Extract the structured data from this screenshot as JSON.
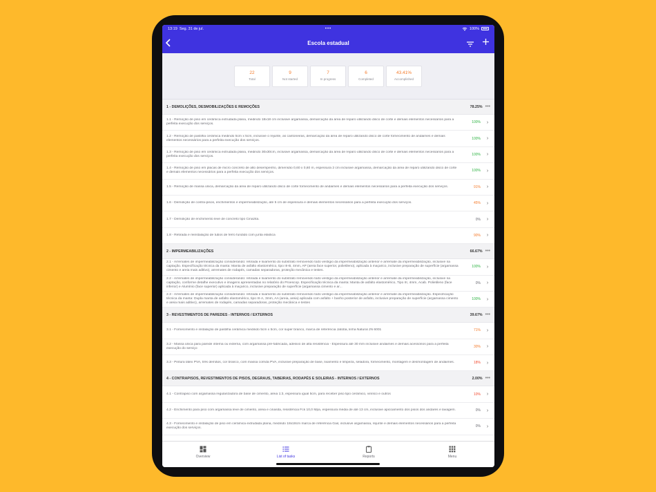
{
  "status": {
    "time": "13:19",
    "date": "Seg. 31 de jul.",
    "center": "•••",
    "battery": "100%"
  },
  "nav": {
    "title": "Escola estadual"
  },
  "colors": {
    "accent": "#3F33E0",
    "green": "#2FB344",
    "orange": "#F47A2A",
    "red": "#F2492E",
    "gray": "#6a6a72"
  },
  "stats": [
    {
      "value": "22",
      "label": "Total"
    },
    {
      "value": "9",
      "label": "Not started"
    },
    {
      "value": "7",
      "label": "In progress"
    },
    {
      "value": "6",
      "label": "Completed"
    },
    {
      "value": "43.41%",
      "label": "Accomplished"
    }
  ],
  "sections": [
    {
      "title": "1 - DEMOLIÇÕES, DESMOBILIZAÇÕES E REMOÇÕES",
      "percent": "78.25%",
      "items": [
        {
          "text": "1.1 - Remoção de piso em cerâmica extrudada plana, medindo 18x18 cm inclusive argamassa, demarcação da área de reparo utilizando disco de corte e demais elementos necessários para a perfeita execução dos serviços.",
          "percent": "100%",
          "status": "green"
        },
        {
          "text": "1.2 - Remoção de pastilha cerâmica medindo 5cm x 5cm, inclusive o rejunte, as cantoneiras, demarcação da área de reparo utilizando disco de corte fornecimento de andaimes e demais elementos necessários para a perfeita execução dos serviços.",
          "percent": "100%",
          "status": "green"
        },
        {
          "text": "1.3 - Remoção de piso em cerâmica extrudada plana, medindo 30x30cm, inclusive argamassa, demarcação da área de reparo utilizando disco de corte e demais elementos necessários para a perfeita execução dos serviços.",
          "percent": "100%",
          "status": "green"
        },
        {
          "text": "1.4 - Remoção de piso em placas de micro concreto de alto desempenho, dimensão 0,60 x 0,60 m, espessura 2 cm inclusive argamassa, demarcação da área de reparo utilizando disco de corte e demais elementos necessários para a perfeita execução dos serviços.",
          "percent": "100%",
          "status": "green"
        },
        {
          "text": "1.5 - Remoção de massa única, demarcação da área de reparo utilizando disco de corte fornecimento de andaimes e demais elementos necessários para a perfeita execução dos serviços.",
          "percent": "91%",
          "status": "orange"
        },
        {
          "text": "1.6 - Demolição de contra-pisos, enchimentos e impermeabilização, até 5 cm de espessura e demais elementos necessários para a perfeita execução dos serviços.",
          "percent": "45%",
          "status": "orange"
        },
        {
          "text": "1.7 - Demolição de enchimento leve de concreto tipo Cinazita.",
          "percent": "0%",
          "status": "gray"
        },
        {
          "text": "1.8 - Retirada e reinstalação de tubos de ferro fundido com junta elástica",
          "percent": "90%",
          "status": "orange"
        }
      ]
    },
    {
      "title": "2 - IMPERMEABILIZAÇÕES",
      "percent": "66.67%",
      "items": [
        {
          "text": "2.1 - Arremates de impermeabilização considerando: retirada e lixamento do substrato removendo todo vestígio da impermeabilização anterior e arremate da impermeabilização, inclusive na captação. Especificação técnica da manta: Manta de asfalto elastomérico, tipo III-B, 4mm, AP (areia face superior, polietileno), aplicada à maçarico, inclusive preparação de superfície (argamassa cimento e areia mais aditivo), arremates de rodapés, camadas separadoras, proteção mecânica e testes.",
          "percent": "100%",
          "status": "green"
        },
        {
          "text": "2.2 - Arremates de impermeabilização considerando: retirada e lixamento do substrato removendo todo vestígio da impermeabilização anterior e arremate da impermeabilização, inclusive na captação, conforme detalhe executivo e imagens apresentadas no relatório do Proescop. Especificação técnica da manta: Manta de asfalto elastomérico, Tipo III, 4mm, Acab. Polietileno (face inferior) e Alumínio (face superior) aplicada à maçarico, inclusive preparação de superfície (argamassa cimento e ar...",
          "percent": "0%",
          "status": "gray"
        },
        {
          "text": "2.3 - Arremates de impermeabilização considerando: retirada e lixamento do substrato removendo todo vestígio da impermeabilização anterior e arremate da impermeabilização. Especificação técnica da manta: Dupla manta de asfalto elastomérico, tipo III-A, 3mm, AA (areia, areia) aplicada com asfalto + banho posterior de asfalto, inclusive preparação de superfície (argamassa cimento e areia mais aditivo), arremates de rodapés, camadas separadoras, proteção mecânica e testes",
          "percent": "100%",
          "status": "green"
        }
      ]
    },
    {
      "title": "3 - REVESTIMENTOS DE PAREDES - INTERNOS / EXTERNOS",
      "percent": "39.67%",
      "items": [
        {
          "text": "3.1 - Fornecimento e instalação de pastilha cerâmica medindo 5cm x 5cm, cor super branco, marca de referência Jatobá, linha Natural JN 6001",
          "percent": "71%",
          "status": "orange"
        },
        {
          "text": "3.2 - Massa única para parede interna ou externa, com argamassa pré-fabricada, adesivo de alta resistência - Espessura até 30 mm inclusive andaimes e demais acessórios para a perfeita execução do serviço",
          "percent": "30%",
          "status": "orange"
        },
        {
          "text": "3.3 - Pintura látex PVA, três demãos, cor branco, com massa corrida PVA, inclusive preparação de base, lixamento e limpeza, seladora, fornecimento, montagem e desmontagem de andaimes.",
          "percent": "18%",
          "status": "red"
        }
      ]
    },
    {
      "title": "4 - CONTRAPISOS, REVESTIMENTOS DE PISOS, DEGRAUS, TABEIRAS, RODAPÉS E SOLEIRAS - INTERNOS / EXTERNOS",
      "percent": "2.00%",
      "items": [
        {
          "text": "4.1 - Contrapiso com argamassa regularizadora de base de cimento, areia 1:3, espessura igual 5cm, para receber piso tipo cerâmico, vinílico e outros",
          "percent": "10%",
          "status": "red"
        },
        {
          "text": "4.2 - Enchimento para piso com argamassa leve de cimento, areia e cinasita, resistência Fck 10,0 Mpa, espessura média de até 13 cm, inclusive apicoamento dos pisos dos andares e lavagem.",
          "percent": "0%",
          "status": "gray"
        },
        {
          "text": "4.3 - Fornecimento e instalação de piso em cerâmica extrudada plana, medindo 18x18cm marca de referência Gail, inclusive argamassa, rejunte e demais elementos necessários para a perfeita execução dos serviços.",
          "percent": "0%",
          "status": "gray"
        }
      ]
    }
  ],
  "tabs": [
    {
      "label": "Overview",
      "icon": "dashboard-icon"
    },
    {
      "label": "List of tasks",
      "icon": "list-icon"
    },
    {
      "label": "Reports",
      "icon": "clipboard-icon"
    },
    {
      "label": "Menu",
      "icon": "grid-icon"
    }
  ]
}
